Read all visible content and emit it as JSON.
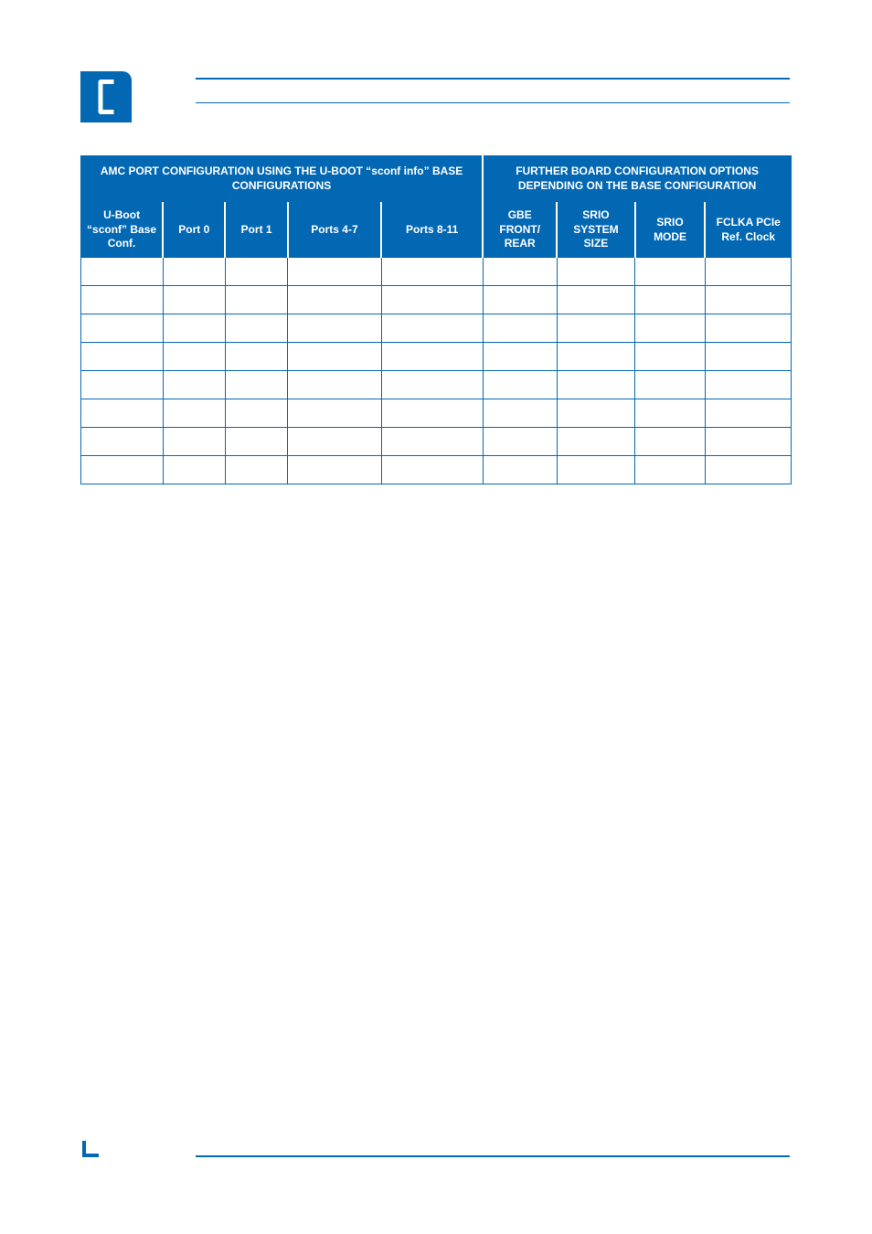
{
  "headers": {
    "group_left": "AMC PORT CONFIGURATION USING THE U-BOOT “sconf info” BASE CONFIGURATIONS",
    "group_right": "FURTHER BOARD CONFIGURATION OPTIONS DEPENDING ON THE BASE CONFIGURATION",
    "cols": [
      "U-Boot “sconf” Base Conf.",
      "Port 0",
      "Port 1",
      "Ports 4-7",
      "Ports 8-11",
      "GBE FRONT/ REAR",
      "SRIO SYSTEM SIZE",
      "SRIO MODE",
      "FCLKA PCIe Ref. Clock"
    ]
  },
  "chart_data": {
    "type": "table",
    "title": "",
    "column_groups": [
      {
        "label": "AMC PORT CONFIGURATION USING THE U-BOOT “sconf info” BASE CONFIGURATIONS",
        "span": 5
      },
      {
        "label": "FURTHER BOARD CONFIGURATION OPTIONS DEPENDING ON THE BASE CONFIGURATION",
        "span": 4
      }
    ],
    "columns": [
      "U-Boot “sconf” Base Conf.",
      "Port 0",
      "Port 1",
      "Ports 4-7",
      "Ports 8-11",
      "GBE FRONT/ REAR",
      "SRIO SYSTEM SIZE",
      "SRIO MODE",
      "FCLKA PCIe Ref. Clock"
    ],
    "rows": [
      [
        "",
        "",
        "",
        "",
        "",
        "",
        "",
        "",
        ""
      ],
      [
        "",
        "",
        "",
        "",
        "",
        "",
        "",
        "",
        ""
      ],
      [
        "",
        "",
        "",
        "",
        "",
        "",
        "",
        "",
        ""
      ],
      [
        "",
        "",
        "",
        "",
        "",
        "",
        "",
        "",
        ""
      ],
      [
        "",
        "",
        "",
        "",
        "",
        "",
        "",
        "",
        ""
      ],
      [
        "",
        "",
        "",
        "",
        "",
        "",
        "",
        "",
        ""
      ],
      [
        "",
        "",
        "",
        "",
        "",
        "",
        "",
        "",
        ""
      ],
      [
        "",
        "",
        "",
        "",
        "",
        "",
        "",
        "",
        ""
      ]
    ]
  }
}
